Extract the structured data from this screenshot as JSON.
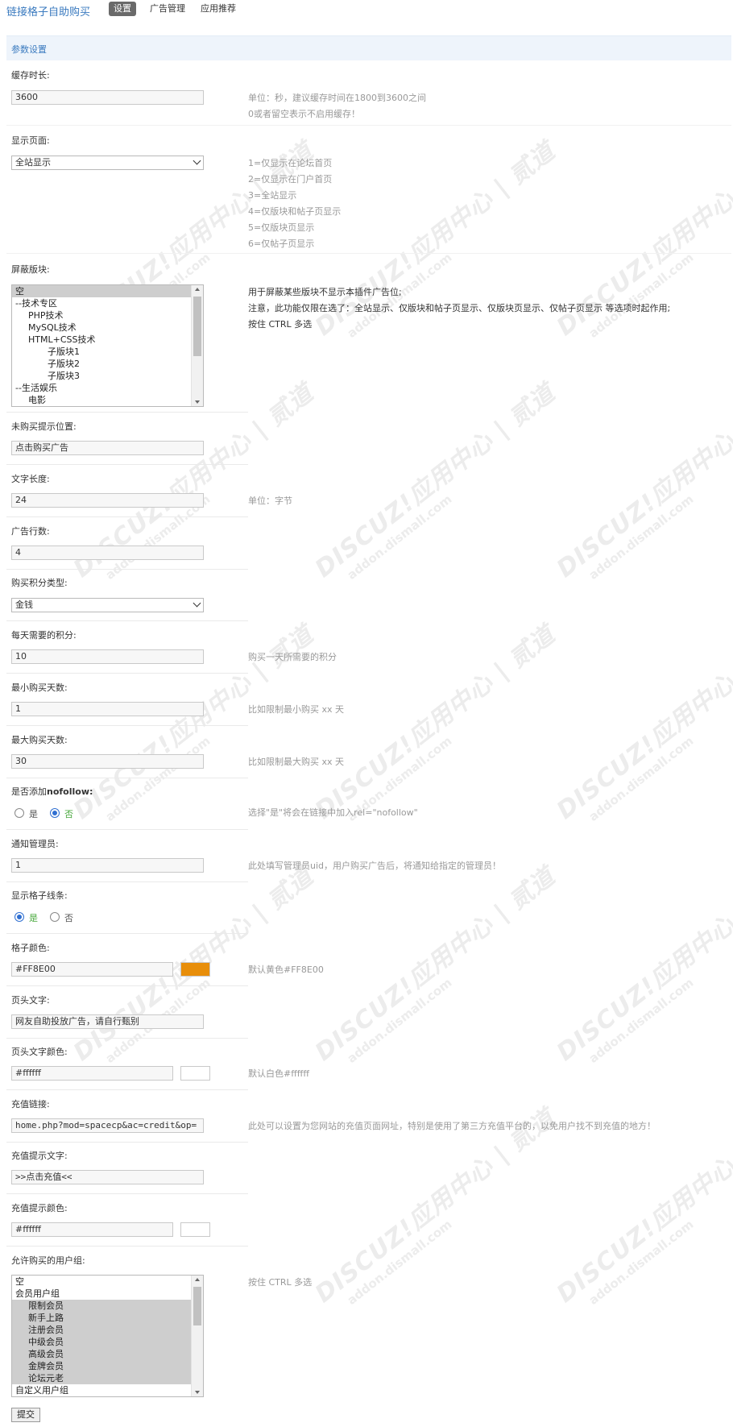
{
  "header": {
    "brand": "链接格子自助购买",
    "tabs": [
      {
        "label": "设置",
        "active": true
      },
      {
        "label": "广告管理",
        "active": false
      },
      {
        "label": "应用推荐",
        "active": false
      }
    ]
  },
  "section": {
    "title": "参数设置"
  },
  "watermark": {
    "line1": "DISCUZ!应用中心 | 贰道",
    "line2": "addon.dismall.com"
  },
  "fields": {
    "cache": {
      "label": "缓存时长:",
      "value": "3600",
      "hint1": "单位：秒，建议缓存时间在1800到3600之间",
      "hint2": "0或者留空表示不启用缓存！"
    },
    "display_page": {
      "label": "显示页面:",
      "value": "全站显示",
      "hints": [
        "1=仅显示在论坛首页",
        "2=仅显示在门户首页",
        "3=全站显示",
        "4=仅版块和帖子页显示",
        "5=仅版块页显示",
        "6=仅帖子页显示"
      ]
    },
    "block_forums": {
      "label": "屏蔽版块:",
      "options": [
        "空",
        "--技术专区",
        "PHP技术",
        "MySQL技术",
        "HTML+CSS技术",
        "子版块1",
        "子版块2",
        "子版块3",
        "--生活娱乐",
        "电影"
      ],
      "hint1": "用于屏蔽某些版块不显示本插件广告位;",
      "hint2": "注意，此功能仅限在选了：全站显示、仅版块和帖子页显示、仅版块页显示、仅帖子页显示 等选项时起作用;",
      "hint3": "按住 CTRL 多选"
    },
    "unbought_tip": {
      "label": "未购买提示位置:",
      "value": "点击购买广告"
    },
    "text_length": {
      "label": "文字长度:",
      "value": "24",
      "hint": "单位：字节"
    },
    "ad_rows": {
      "label": "广告行数:",
      "value": "4"
    },
    "credit_type": {
      "label": "购买积分类型:",
      "value": "金钱"
    },
    "daily_credit": {
      "label": "每天需要的积分:",
      "value": "10",
      "hint": "购买一天所需要的积分"
    },
    "min_days": {
      "label": "最小购买天数:",
      "value": "1",
      "hint": "比如限制最小购买 xx 天"
    },
    "max_days": {
      "label": "最大购买天数:",
      "value": "30",
      "hint": "比如限制最大购买 xx 天"
    },
    "nofollow": {
      "label_prefix": "是否添加",
      "label_bold": "nofollow:",
      "yes": "是",
      "no": "否",
      "hint": "选择\"是\"将会在链接中加入rel=\"nofollow\""
    },
    "notify_admin": {
      "label": "通知管理员:",
      "value": "1",
      "hint": "此处填写管理员uid，用户购买广告后，将通知给指定的管理员！"
    },
    "grid_lines": {
      "label": "显示格子线条:",
      "yes": "是",
      "no": "否"
    },
    "grid_color": {
      "label": "格子颜色:",
      "value": "#FF8E00",
      "hint": "默认黄色#FF8E00",
      "swatch": "#E88E0A"
    },
    "header_text": {
      "label": "页头文字:",
      "value": "网友自助投放广告，请自行甄别"
    },
    "header_color": {
      "label": "页头文字颜色:",
      "value": "#ffffff",
      "hint": "默认白色#ffffff",
      "swatch": "#ffffff"
    },
    "recharge_link": {
      "label": "充值链接:",
      "value": "home.php?mod=spacecp&ac=credit&op=",
      "hint": "此处可以设置为您网站的充值页面网址，特别是使用了第三方充值平台的，以免用户找不到充值的地方！"
    },
    "recharge_tip": {
      "label": "充值提示文字:",
      "value": ">>点击充值<<"
    },
    "recharge_color": {
      "label": "充值提示颜色:",
      "value": "#ffffff",
      "swatch": "#ffffff"
    },
    "allowed_groups": {
      "label": "允许购买的用户组:",
      "options": [
        "空",
        "会员用户组",
        "限制会员",
        "新手上路",
        "注册会员",
        "中级会员",
        "高级会员",
        "金牌会员",
        "论坛元老",
        "自定义用户组"
      ],
      "hint": "按住 CTRL 多选"
    }
  },
  "submit_label": "提交"
}
